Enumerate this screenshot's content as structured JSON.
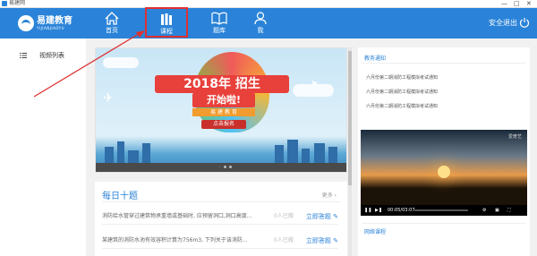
{
  "window": {
    "title": "易建网",
    "minimize": "—",
    "maximize": "□",
    "close": "✕"
  },
  "brand": {
    "name_cn": "易建教育",
    "name_en": "YIJIANJIAOYU"
  },
  "nav": {
    "items": [
      {
        "label": "首页",
        "icon": "home-icon"
      },
      {
        "label": "课程",
        "icon": "course-icon",
        "active": true
      },
      {
        "label": "题库",
        "icon": "book-icon"
      },
      {
        "label": "我",
        "icon": "user-icon"
      }
    ],
    "exit_label": "安全退出"
  },
  "sidebar": {
    "items": [
      {
        "label": "视频列表",
        "icon": "list-icon"
      }
    ]
  },
  "banner": {
    "headline": "2018年 招生",
    "subline": "开始啦!",
    "brand_line": "易 建 教 育",
    "cta": "点击报名"
  },
  "daily": {
    "title": "每日十题",
    "more": "更多 ›",
    "questions": [
      {
        "text": "消防给水管穿过建筑物承重墙或基础时, 应预留洞口,洞口高度...",
        "count": "0人已做",
        "action": "立即答题"
      },
      {
        "text": "某建筑的消防水池有效容积计算为756m3, 下列关于该消防...",
        "count": "0人已做",
        "action": "立即答题"
      }
    ]
  },
  "notices": {
    "title": "教务通知",
    "items": [
      "六月份第二期消防工程模拟考试通知",
      "六月份第二期消防工程模拟考试通知",
      "六月份第二期消防工程模拟考试通知"
    ]
  },
  "video": {
    "brand": "爱奇艺",
    "time": "00:05/03:07"
  },
  "online": {
    "title": "网络课程"
  },
  "colors": {
    "nav_bg": "#2a83d8",
    "accent": "#2a83d8",
    "highlight": "#e03030"
  }
}
